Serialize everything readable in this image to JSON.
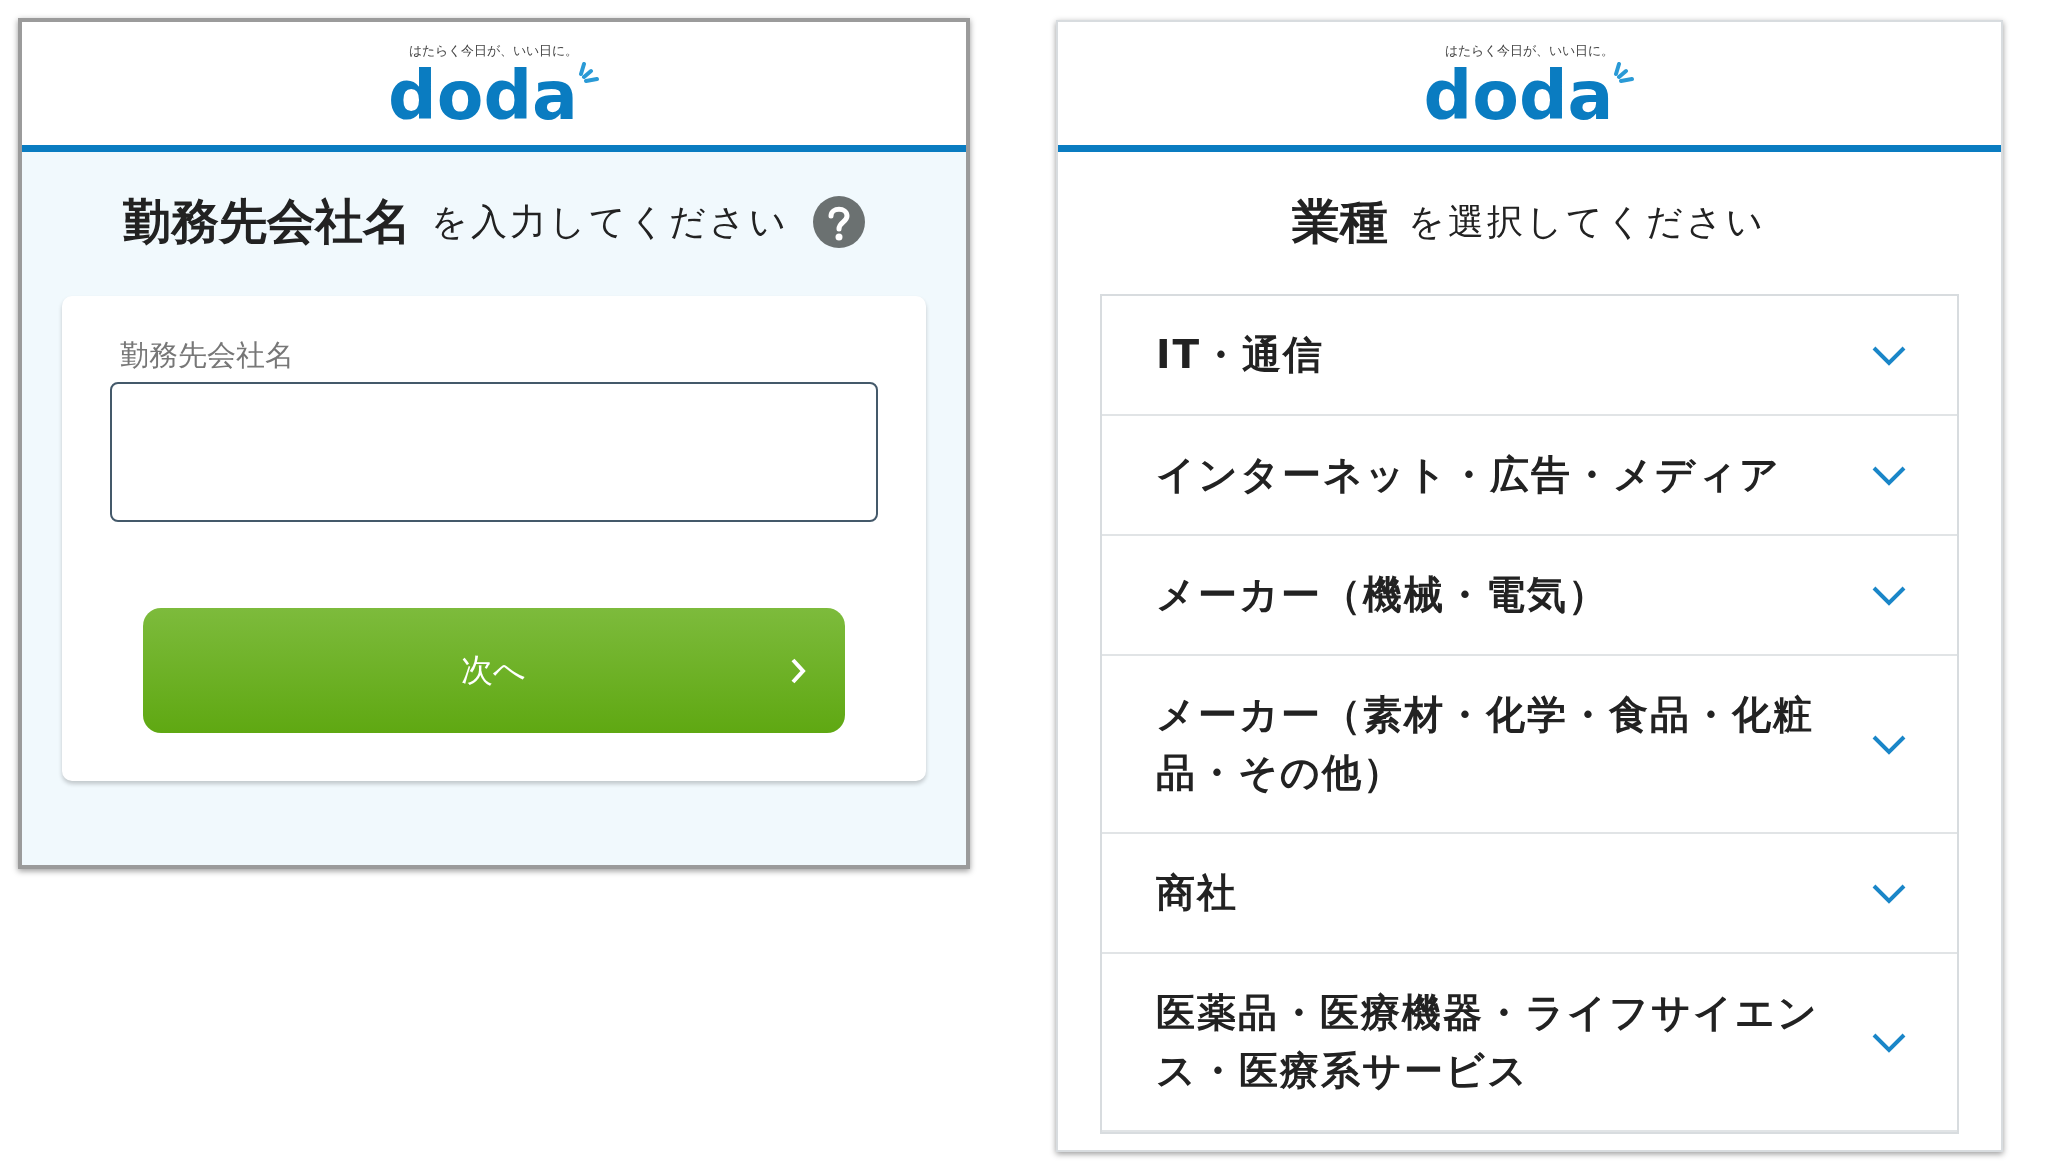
{
  "screens": [
    {
      "kind": "form",
      "tagline": "はたらく今日が、いい日に。",
      "logo": "doda",
      "heading": {
        "strong": "勤務先会社名",
        "rest": "を入力してください"
      },
      "help": true,
      "field": {
        "label": "勤務先会社名"
      },
      "button": {
        "label": "次へ"
      }
    },
    {
      "kind": "list",
      "tagline": "はたらく今日が、いい日に。",
      "logo": "doda",
      "heading": {
        "strong": "業種",
        "rest": "を選択してください"
      },
      "help": false,
      "items": [
        {
          "label": "IT・通信",
          "expanded": false
        },
        {
          "label": "インターネット・広告・メディア",
          "expanded": false
        },
        {
          "label": "メーカー（機械・電気）",
          "expanded": false
        },
        {
          "label": "メーカー（素材・化学・食品・化粧品・その他）",
          "expanded": false
        },
        {
          "label": "商社",
          "expanded": false
        },
        {
          "label": "医薬品・医療機器・ライフサイエンス・医療系サービス",
          "expanded": false
        }
      ]
    }
  ]
}
